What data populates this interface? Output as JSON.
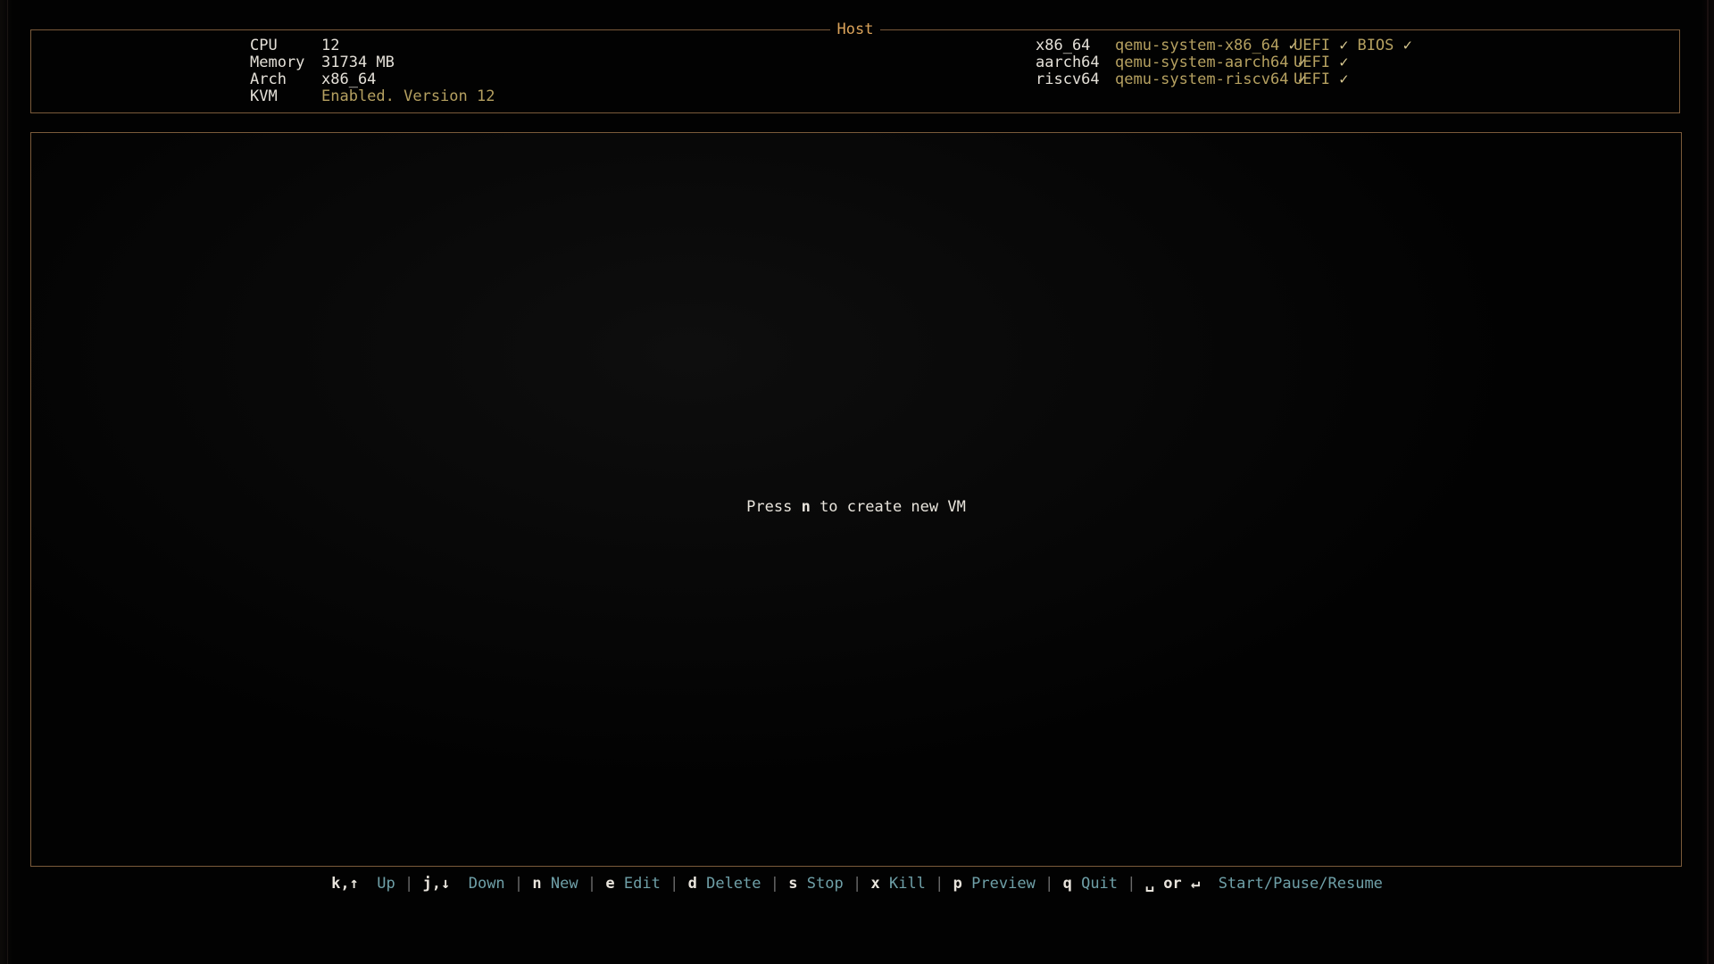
{
  "host": {
    "title": "Host",
    "info": [
      {
        "label": "CPU",
        "value": "12"
      },
      {
        "label": "Memory",
        "value": "31734 MB"
      },
      {
        "label": "Arch",
        "value": "x86_64"
      },
      {
        "label": "KVM",
        "value": "Enabled. Version 12"
      }
    ],
    "architectures": [
      {
        "arch": "x86_64",
        "binary": "qemu-system-x86_64",
        "firmware": [
          "UEFI",
          "BIOS"
        ]
      },
      {
        "arch": "aarch64",
        "binary": "qemu-system-aarch64",
        "firmware": [
          "UEFI"
        ]
      },
      {
        "arch": "riscv64",
        "binary": "qemu-system-riscv64",
        "firmware": [
          "UEFI"
        ]
      }
    ],
    "check_glyph": "✓"
  },
  "vm_list": {
    "empty_prefix": "Press ",
    "empty_key": "n",
    "empty_suffix": " to create new VM"
  },
  "hints": [
    {
      "key": "k,↑",
      "label": "Up"
    },
    {
      "key": "j,↓",
      "label": "Down"
    },
    {
      "key": "n",
      "label": "New"
    },
    {
      "key": "e",
      "label": "Edit"
    },
    {
      "key": "d",
      "label": "Delete"
    },
    {
      "key": "s",
      "label": "Stop"
    },
    {
      "key": "x",
      "label": "Kill"
    },
    {
      "key": "p",
      "label": "Preview"
    },
    {
      "key": "q",
      "label": "Quit"
    },
    {
      "key": "␣ or ↵",
      "label": "Start/Pause/Resume"
    }
  ],
  "hint_separator": "|",
  "colors": {
    "border": "#7a5a3a",
    "title": "#d9a25a",
    "accent": "#b5a060",
    "hint_label": "#6fa0a8"
  }
}
